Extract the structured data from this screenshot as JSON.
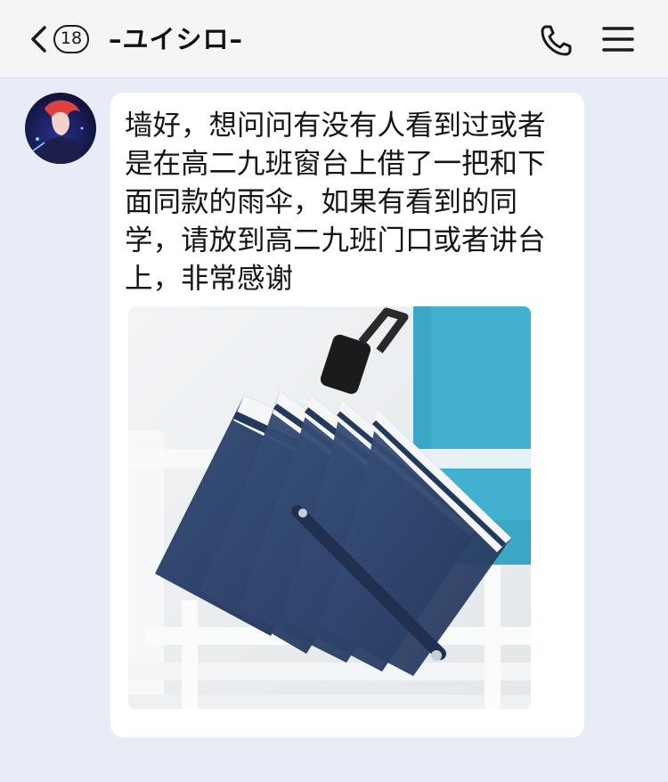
{
  "header": {
    "back_icon": "chevron-left-icon",
    "unread_count": "18",
    "title": "–ユイシロ–",
    "call_icon": "phone-icon",
    "menu_icon": "hamburger-menu-icon"
  },
  "message": {
    "text": "墙好，想问问有没有人看到过或者是在高二九班窗台上借了一把和下面同款的雨伞，如果有看到的同学，请放到高二九班门口或者讲台上，非常感谢",
    "image_subject": "navy-umbrella-photo"
  },
  "colors": {
    "background": "#e8ecf6",
    "header": "#f5f5f6",
    "bubble": "#ffffff",
    "umbrella_navy": "#2f456b"
  }
}
